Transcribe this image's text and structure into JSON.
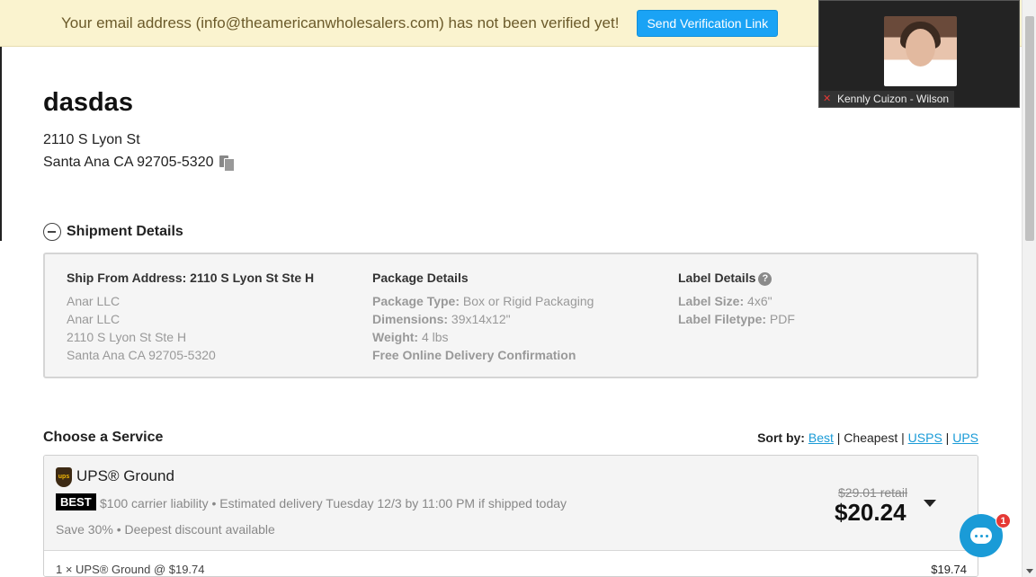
{
  "banner": {
    "message": "Your email address (info@theamericanwholesalers.com) has not been verified yet!",
    "button_label": "Send Verification Link"
  },
  "video": {
    "participant_name": "Kennly Cuizon - Wilson"
  },
  "order": {
    "title": "dasdas",
    "address_line1": "2110 S Lyon St",
    "address_line2": "Santa Ana CA 92705-5320"
  },
  "shipment": {
    "toggle_label": "Shipment Details",
    "ship_from": {
      "heading": "Ship From Address: 2110 S Lyon St Ste H",
      "lines": [
        "Anar LLC",
        "Anar LLC",
        "2110 S Lyon St Ste H",
        "Santa Ana CA 92705-5320"
      ]
    },
    "package": {
      "heading": "Package Details",
      "type_label": "Package Type:",
      "type_value": "Box or Rigid Packaging",
      "dims_label": "Dimensions:",
      "dims_value": "39x14x12\"",
      "weight_label": "Weight:",
      "weight_value": "4 lbs",
      "confirmation": "Free Online Delivery Confirmation"
    },
    "label": {
      "heading": "Label Details",
      "help_glyph": "?",
      "size_label": "Label Size:",
      "size_value": "4x6\"",
      "filetype_label": "Label Filetype:",
      "filetype_value": "PDF"
    }
  },
  "services": {
    "heading": "Choose a Service",
    "sort_label": "Sort by:",
    "sort_options": [
      "Best",
      "Cheapest",
      "USPS",
      "UPS"
    ],
    "selected_sort": "Cheapest",
    "card": {
      "logo_text": "ups",
      "name": "UPS® Ground",
      "badge": "BEST",
      "description": "$100 carrier liability • Estimated delivery Tuesday 12/3 by 11:00 PM if shipped today",
      "savings": "Save 30% • Deepest discount available",
      "retail_price": "$29.01 retail",
      "price": "$20.24",
      "line_item": "1 × UPS® Ground @ $19.74",
      "line_total": "$19.74"
    }
  },
  "chat": {
    "badge_count": "1"
  }
}
